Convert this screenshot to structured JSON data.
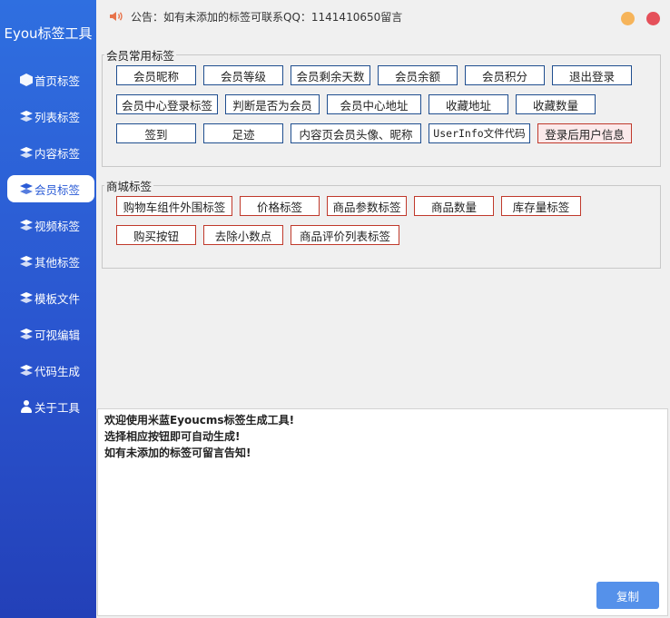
{
  "app": {
    "title": "Eyou标签工具"
  },
  "sidebar": {
    "items": [
      {
        "label": "首页标签",
        "icon": "cube-icon"
      },
      {
        "label": "列表标签",
        "icon": "layers-icon"
      },
      {
        "label": "内容标签",
        "icon": "layers-icon"
      },
      {
        "label": "会员标签",
        "icon": "layers-icon",
        "active": true
      },
      {
        "label": "视频标签",
        "icon": "layers-icon"
      },
      {
        "label": "其他标签",
        "icon": "layers-icon"
      },
      {
        "label": "模板文件",
        "icon": "layers-icon"
      },
      {
        "label": "可视编辑",
        "icon": "layers-icon"
      },
      {
        "label": "代码生成",
        "icon": "layers-icon"
      },
      {
        "label": "关于工具",
        "icon": "user-icon"
      }
    ]
  },
  "topbar": {
    "notice": "公告：如有未添加的标签可联系QQ：1141410650留言"
  },
  "member_group": {
    "legend": "会员常用标签",
    "buttons": [
      "会员昵称",
      "会员等级",
      "会员剩余天数",
      "会员余额",
      "会员积分",
      "退出登录",
      "会员中心登录标签",
      "判断是否为会员",
      "会员中心地址",
      "收藏地址",
      "收藏数量",
      "签到",
      "足迹",
      "内容页会员头像、昵称",
      "UserInfo文件代码",
      "登录后用户信息"
    ]
  },
  "shop_group": {
    "legend": "商城标签",
    "buttons": [
      "购物车组件外围标签",
      "价格标签",
      "商品参数标签",
      "商品数量",
      "库存量标签",
      "购买按钮",
      "去除小数点",
      "商品评价列表标签"
    ]
  },
  "output": {
    "lines": [
      "欢迎使用米蓝Eyoucms标签生成工具!",
      "选择相应按钮即可自动生成!",
      "如有未添加的标签可留言告知!"
    ]
  },
  "copy_button": "复制",
  "colors": {
    "sidebar": "#2a55cf",
    "accent": "#5591ea",
    "blue_border": "#1f4e8f",
    "red_border": "#c0392b"
  }
}
